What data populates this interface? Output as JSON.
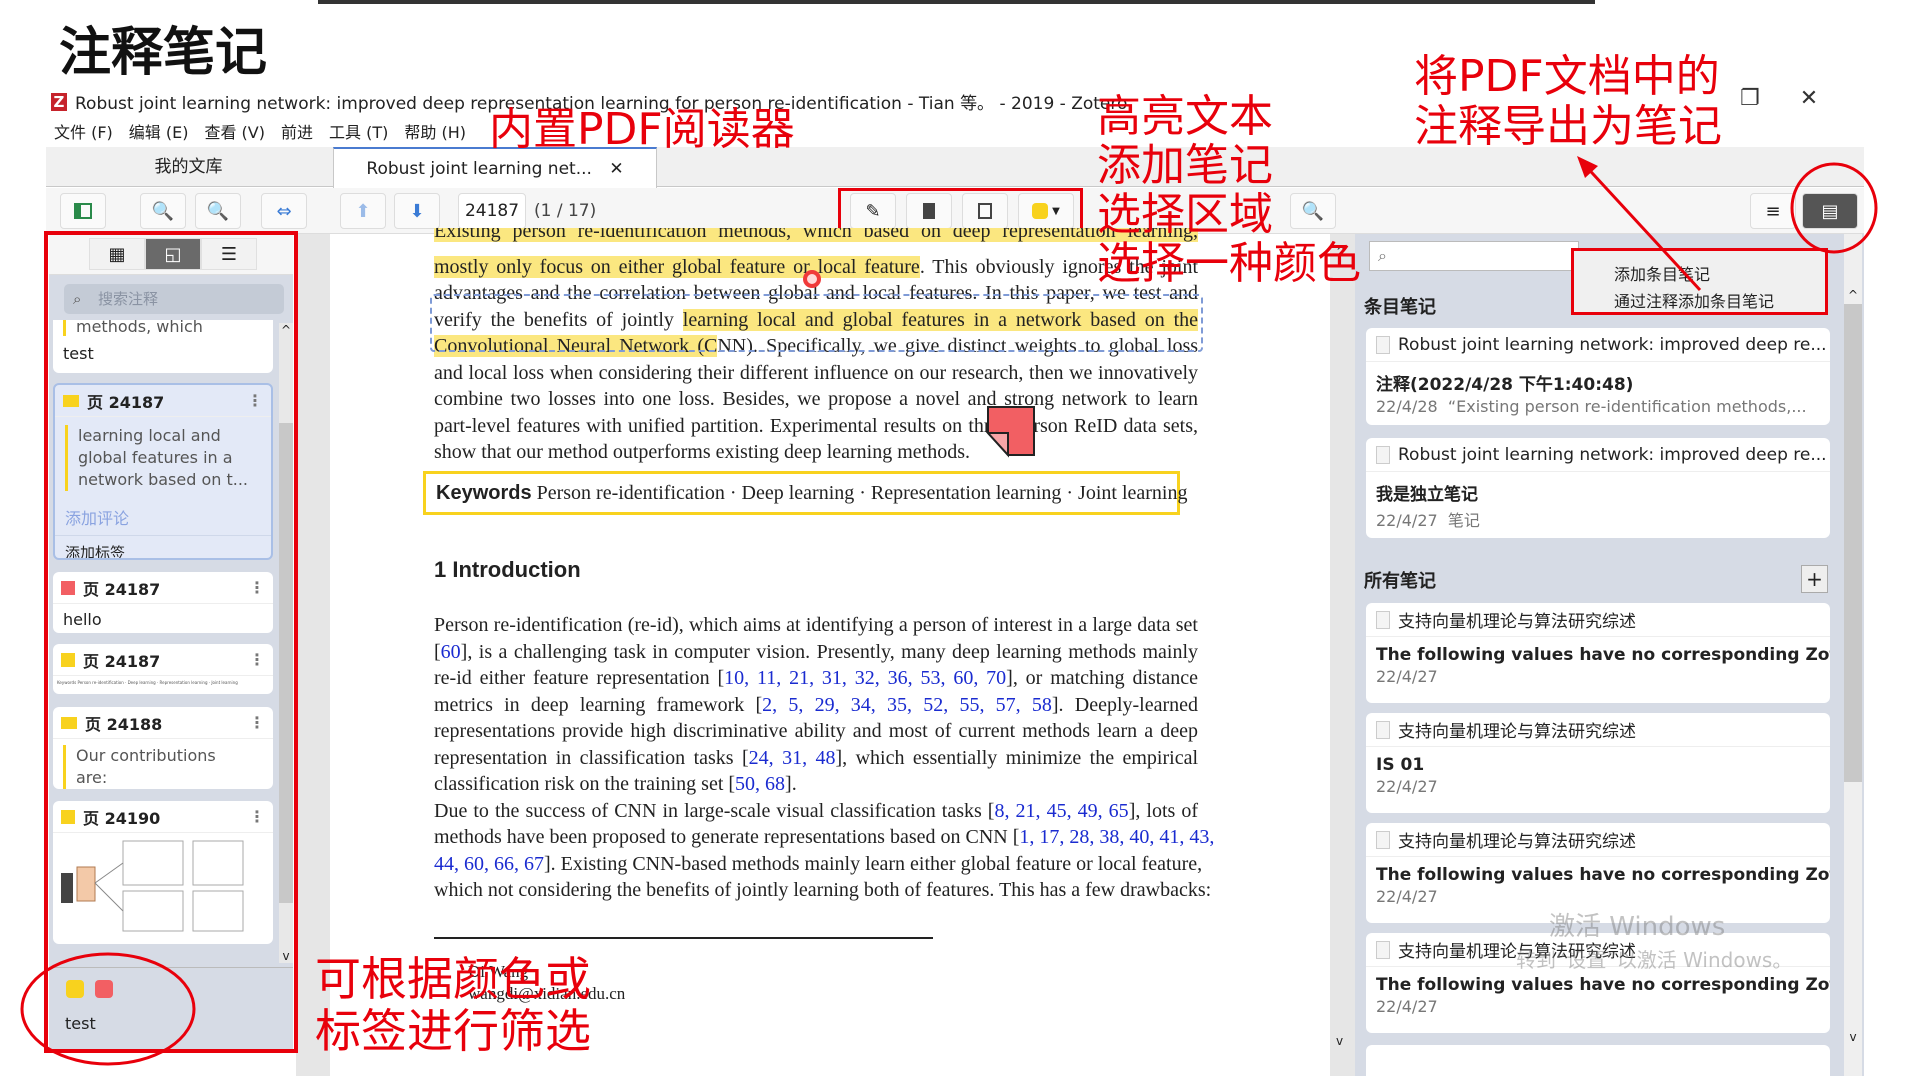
{
  "overlay": {
    "title": "注释笔记",
    "label_reader": "内置PDF阅读器",
    "label_tools": [
      "高亮文本",
      "添加笔记",
      "选择区域",
      "选择一种颜色"
    ],
    "label_export": [
      "将PDF文档中的",
      "注释导出为笔记"
    ],
    "label_filter": [
      "可根据颜色或",
      "标签进行筛选"
    ],
    "annotation_color": "#e8000b"
  },
  "window": {
    "title": "Robust joint learning network: improved deep representation learning for person re-identification - Tian 等。 - 2019 - Zotero",
    "restore_icon": "❐",
    "close_icon": "✕"
  },
  "menu": [
    "文件 (F)",
    "编辑 (E)",
    "查看 (V)",
    "前进",
    "工具 (T)",
    "帮助 (H)"
  ],
  "tabs": {
    "library": "我的文库",
    "document": "Robust joint learning net...",
    "close": "✕"
  },
  "toolbar": {
    "page_value": "24187",
    "page_count": "(1 / 17)",
    "highlight_color": "#f8d21e"
  },
  "sidebar": {
    "search_placeholder": "搜索注释",
    "cards": [
      {
        "text": "methods, which",
        "comment": "test"
      },
      {
        "page": "页 24187",
        "text": [
          "learning local and",
          "global features in a",
          "network based on t..."
        ],
        "add_comment": "添加评论",
        "add_tag": "添加标签",
        "color": "#f8d21e"
      },
      {
        "page": "页 24187",
        "comment": "hello",
        "color": "#f25f63"
      },
      {
        "page": "页 24187",
        "snippet": "Keywords Person re-identification · Deep learning · Representation learning · Joint learning",
        "color": "#f8d21e"
      },
      {
        "page": "页 24188",
        "text": [
          "Our contributions",
          "are:"
        ],
        "color": "#f8d21e"
      },
      {
        "page": "页 24190",
        "color": "#f8d21e"
      }
    ],
    "filter_colors": [
      "#f8d21e",
      "#f25f63"
    ],
    "filter_tag": "test"
  },
  "pdf": {
    "abstract_lines": [
      [
        {
          "t": "Existing person re-identification methods, which based on deep representation learning,",
          "hl": true
        }
      ],
      [
        {
          "t": "mostly only focus on either global feature or local feature",
          "hl": true
        },
        {
          "t": ". This obviously ignores the joint"
        }
      ],
      [
        {
          "t": "advantages and the correlation between global and local features. In this paper, we test and"
        }
      ],
      [
        {
          "t": "verify the benefits of jointly "
        },
        {
          "t": "learning local and global features in a network based on the",
          "hl": true
        }
      ],
      [
        {
          "t": "Convolutional Neural Network (C",
          "hl": true
        },
        {
          "t": "NN). Specifically, we give distinct weights to global loss"
        }
      ],
      [
        {
          "t": "and local loss when considering their different influence on our research, then we innovatively"
        }
      ],
      [
        {
          "t": "combine two losses into one loss. Besides, we propose a novel and strong network to learn"
        }
      ],
      [
        {
          "t": "part-level features with unified partition. Experimental results on three person ReID data sets,"
        }
      ],
      [
        {
          "t": "show that our method outperforms existing deep learning methods."
        }
      ]
    ],
    "keywords_label": "Keywords",
    "keywords": "Person re-identification · Deep learning · Representation learning · Joint learning",
    "section": "1 Introduction",
    "intro_lines": [
      [
        {
          "t": "Person re-identification (re-id), which aims at identifying a person of interest in a large data set"
        }
      ],
      [
        {
          "t": "[",
          "k": false
        },
        {
          "t": "60",
          "k": true
        },
        {
          "t": "], is a challenging task in computer vision. Presently, many deep learning methods mainly"
        }
      ],
      [
        {
          "t": "re-id either feature representation ["
        },
        {
          "t": "10, 11, 21, 31, 32, 36, 53, 60, 70",
          "k": true
        },
        {
          "t": "], or matching distance"
        }
      ],
      [
        {
          "t": "metrics in deep learning framework ["
        },
        {
          "t": "2, 5, 29, 34, 35, 52, 55, 57, 58",
          "k": true
        },
        {
          "t": "]. Deeply-learned"
        }
      ],
      [
        {
          "t": "representations provide high discriminative ability and most of current methods learn a deep"
        }
      ],
      [
        {
          "t": "representation in classification tasks ["
        },
        {
          "t": "24, 31, 48",
          "k": true
        },
        {
          "t": "], which essentially minimize the empirical"
        }
      ],
      [
        {
          "t": "classification risk on the training set ["
        },
        {
          "t": "50, 68",
          "k": true
        },
        {
          "t": "]."
        }
      ],
      [
        {
          "t": "    Due to the success of CNN in large-scale visual classification tasks ["
        },
        {
          "t": "8, 21, 45, 49, 65",
          "k": true
        },
        {
          "t": "], lots of"
        }
      ],
      [
        {
          "t": "methods have been proposed to generate representations based on CNN ["
        },
        {
          "t": "1, 17, 28, 38, 40, 41, 43,",
          "k": true
        }
      ],
      [
        {
          "t": "44, 60, 66, 67",
          "k": true
        },
        {
          "t": "]. Existing CNN-based methods mainly learn either global feature or local feature,"
        }
      ],
      [
        {
          "t": "which not considering the benefits of jointly learning both of features. This has a few drawbacks:"
        }
      ]
    ],
    "author": "Di Wang",
    "email": "wangdi@xidian.edu.cn",
    "note_color": "#f25f63"
  },
  "notes_panel": {
    "popup": [
      "添加条目笔记",
      "通过注释添加条目笔记"
    ],
    "item_notes_title": "条目笔记",
    "item_notes": [
      {
        "parent": "Robust joint learning network: improved deep re...",
        "title": "注释(2022/4/28 下午1:40:48)",
        "date": "22/4/28",
        "preview": "“Existing person re-identification methods,..."
      },
      {
        "parent": "Robust joint learning network: improved deep re...",
        "title": "我是独立笔记",
        "date": "22/4/27",
        "preview": "笔记"
      }
    ],
    "all_notes_title": "所有笔记",
    "add": "+",
    "all_notes": [
      {
        "parent": "支持向量机理论与算法研究综述",
        "title": "The following values have no corresponding Zote...",
        "date": "22/4/27"
      },
      {
        "parent": "支持向量机理论与算法研究综述",
        "title": "IS 01",
        "date": "22/4/27"
      },
      {
        "parent": "支持向量机理论与算法研究综述",
        "title": "The following values have no corresponding Zote...",
        "date": "22/4/27"
      },
      {
        "parent": "支持向量机理论与算法研究综述",
        "title": "The following values have no corresponding Zote...",
        "date": "22/4/27"
      }
    ]
  },
  "watermark": [
    "激活 Windows",
    "转到“设置”以激活 Windows。"
  ]
}
